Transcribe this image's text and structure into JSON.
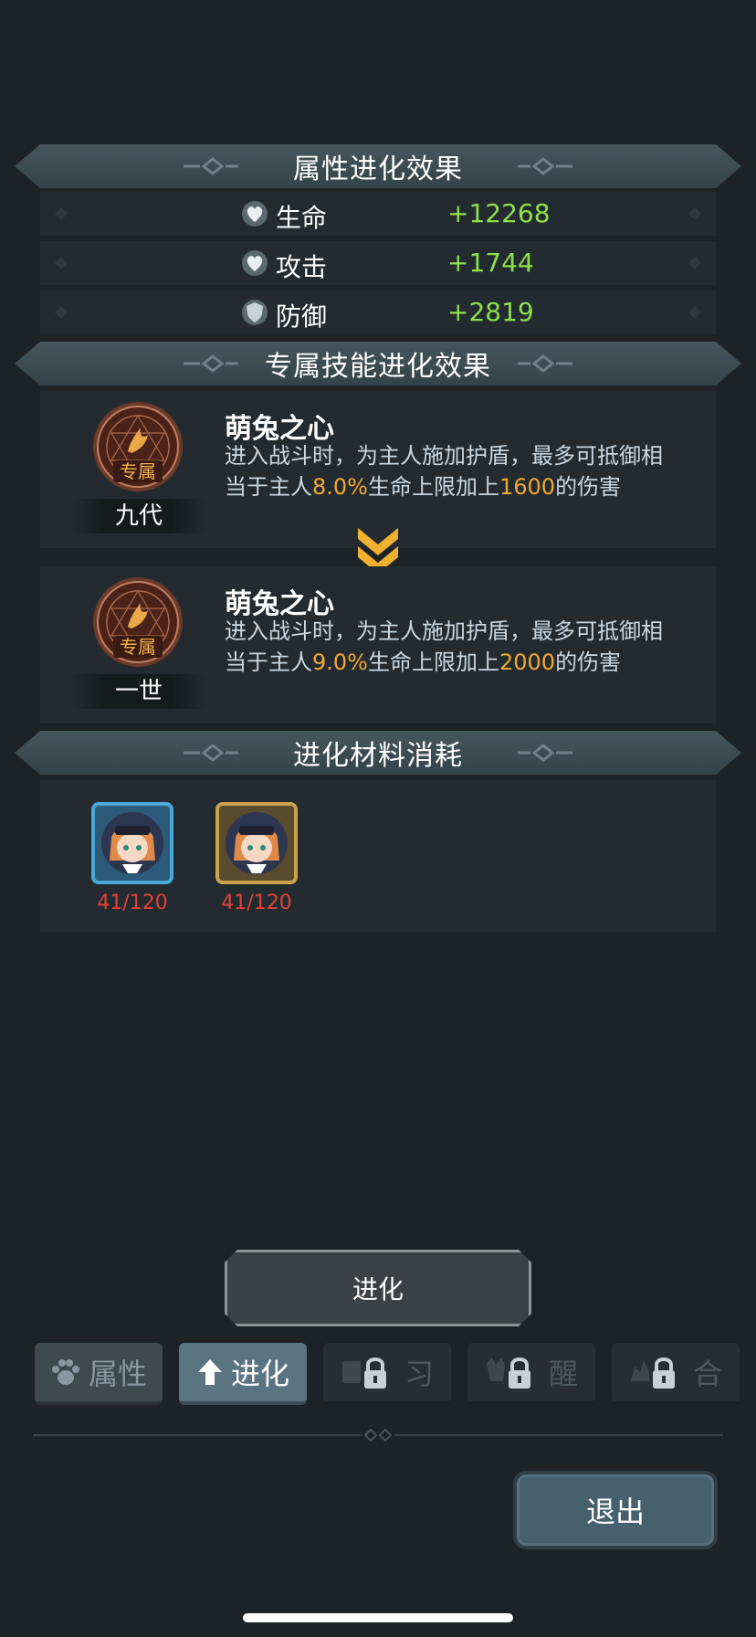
{
  "sections": {
    "attr_title": "属性进化效果",
    "skill_title": "专属技能进化效果",
    "material_title": "进化材料消耗"
  },
  "stats": [
    {
      "label": "生命",
      "value": "+12268",
      "icon": "heart-shield-icon"
    },
    {
      "label": "攻击",
      "value": "+1744",
      "icon": "heart-shield-icon"
    },
    {
      "label": "防御",
      "value": "+2819",
      "icon": "shield-icon"
    }
  ],
  "skill_current": {
    "emblem_text": "专属",
    "tier": "九代",
    "name": "萌兔之心",
    "desc_line1": "进入战斗时，为主人施加护盾，最多可抵御相",
    "desc_prefix": "当于主人",
    "percent": "8.0%",
    "desc_mid": "生命上限加上",
    "flat": "1600",
    "desc_suffix": "的伤害"
  },
  "skill_next": {
    "emblem_text": "专属",
    "tier": "一世",
    "name": "萌兔之心",
    "desc_line1": "进入战斗时，为主人施加护盾，最多可抵御相",
    "desc_prefix": "当于主人",
    "percent": "9.0%",
    "desc_mid": "生命上限加上",
    "flat": "2000",
    "desc_suffix": "的伤害"
  },
  "materials": [
    {
      "count": "41/120",
      "frame": "#4aa8d8"
    },
    {
      "count": "41/120",
      "frame": "#c9a24a"
    }
  ],
  "evolve_button": "进化",
  "tabs": [
    {
      "label": "属性",
      "icon": "paw-icon",
      "state": "inactive"
    },
    {
      "label": "进化",
      "icon": "arrow-up-icon",
      "state": "active"
    },
    {
      "label": "习",
      "icon": "book-lock-icon",
      "state": "locked"
    },
    {
      "label": "醒",
      "icon": "beast-lock-icon",
      "state": "locked"
    },
    {
      "label": "合",
      "icon": "merge-lock-icon",
      "state": "locked"
    }
  ],
  "exit_button": "退出",
  "colors": {
    "stat_value": "#8ee04a",
    "highlight": "#f0a830",
    "insufficient": "#e04038"
  }
}
